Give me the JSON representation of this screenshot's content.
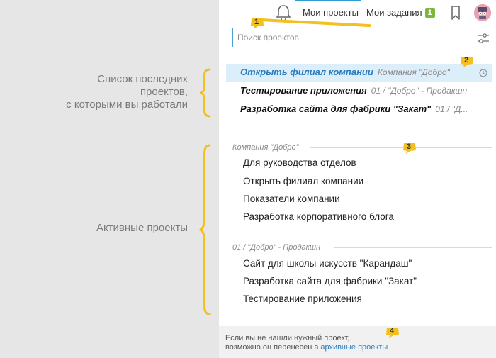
{
  "annotations": {
    "recent_lines": [
      "Список последних",
      "проектов,",
      "с которыми вы работали"
    ],
    "active_label": "Активные проекты"
  },
  "markers": [
    "1",
    "2",
    "3",
    "4"
  ],
  "topbar": {
    "tab_projects": "Мои проекты",
    "tab_tasks": "Мои задания",
    "tasks_badge": "1",
    "icons": [
      "bell-icon",
      "bookmark-icon",
      "avatar"
    ]
  },
  "search": {
    "placeholder": "Поиск проектов",
    "value": ""
  },
  "recent": [
    {
      "name": "Открыть филиал компании",
      "company": "Компания \"Добро\""
    },
    {
      "name": "Тестирование приложения",
      "company": "01 / \"Добро\" - Продакшн"
    },
    {
      "name": "Разработка сайта для фабрики \"Закат\"",
      "company": "01 / \"Д..."
    }
  ],
  "groups": [
    {
      "header": "Компания \"Добро\"",
      "projects": [
        "Для руководства отделов",
        "Открыть филиал компании",
        "Показатели компании",
        "Разработка корпоративного блога"
      ]
    },
    {
      "header": "01 / \"Добро\" - Продакшн",
      "projects": [
        "Сайт для школы искусств \"Карандаш\"",
        "Разработка сайта для фабрики \"Закат\"",
        "Тестирование приложения"
      ]
    }
  ],
  "footer": {
    "line1": "Если вы не нашли нужный проект,",
    "line2_prefix": "возможно он перенесен в",
    "archive_link": "архивные проекты"
  },
  "colors": {
    "accent": "#2a7cc0",
    "highlight": "#dbeefa",
    "marker": "#f4c01f",
    "badge": "#7bb83a"
  }
}
